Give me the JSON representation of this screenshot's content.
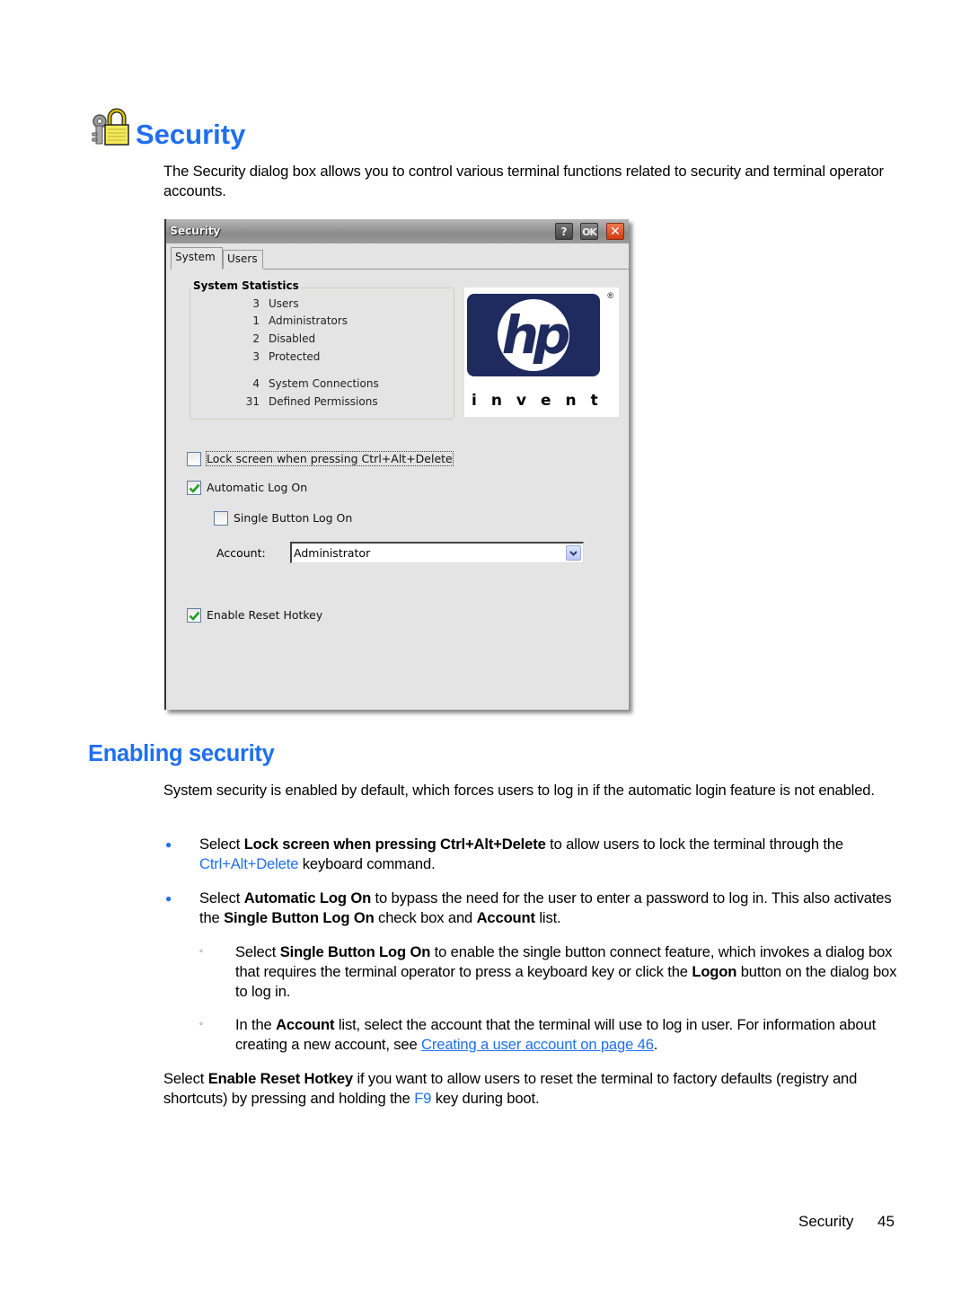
{
  "heading": {
    "title": "Security",
    "icon": "keys-and-padlock-icon"
  },
  "intro": "The Security dialog box allows you to control various terminal functions related to security and terminal operator accounts.",
  "dialog": {
    "title": "Security",
    "buttons": {
      "help": "?",
      "ok": "OK",
      "close": "✕"
    },
    "tabs": [
      {
        "label": "System",
        "active": true
      },
      {
        "label": "Users",
        "active": false
      }
    ],
    "statistics": {
      "title": "System Statistics",
      "rows": [
        {
          "value": "3",
          "label": "Users"
        },
        {
          "value": "1",
          "label": "Administrators"
        },
        {
          "value": "2",
          "label": "Disabled"
        },
        {
          "value": "3",
          "label": "Protected"
        },
        {
          "value": "4",
          "label": "System Connections"
        },
        {
          "value": "31",
          "label": "Defined Permissions"
        }
      ]
    },
    "logo": {
      "text": "hp",
      "tagline": "invent",
      "registered": "®"
    },
    "options": {
      "lock_screen": {
        "label": "Lock screen when pressing Ctrl+Alt+Delete",
        "checked": false
      },
      "auto_logon": {
        "label": "Automatic Log On",
        "checked": true
      },
      "single_button": {
        "label": "Single Button Log On",
        "checked": false
      },
      "account_label": "Account:",
      "account_value": "Administrator",
      "reset_hotkey": {
        "label": "Enable Reset Hotkey",
        "checked": true
      }
    }
  },
  "section2": {
    "title": "Enabling security",
    "intro": "System security is enabled by default, which forces users to log in if the automatic login feature is not enabled.",
    "bullet1": {
      "pre": "Select ",
      "bold": "Lock screen when pressing Ctrl+Alt+Delete",
      "mid": " to allow users to lock the terminal through the ",
      "link": "Ctrl+Alt+Delete",
      "post": " keyboard command."
    },
    "bullet2": {
      "pre": "Select ",
      "bold1": "Automatic Log On",
      "mid1": " to bypass the need for the user to enter a password to log in. This also activates the ",
      "bold2": "Single Button Log On",
      "mid2": " check box and ",
      "bold3": "Account",
      "post": " list."
    },
    "sub1": {
      "pre": "Select ",
      "bold1": "Single Button Log On",
      "mid": " to enable the single button connect feature, which invokes a dialog box that requires the terminal operator to press a keyboard key or click the ",
      "bold2": "Logon",
      "post": " button on the dialog box to log in."
    },
    "sub2": {
      "pre": "In the ",
      "bold": "Account",
      "mid": " list, select the account that the terminal will use to log in user. For information about creating a new account, see ",
      "link": "Creating a user account on page 46",
      "post": "."
    },
    "closing": {
      "pre": "Select ",
      "bold": "Enable Reset Hotkey",
      "mid": " if you want to allow users to reset the terminal to factory defaults (registry and shortcuts) by pressing and holding the ",
      "link": "F9",
      "post": " key during boot."
    }
  },
  "footer": {
    "section": "Security",
    "page": "45"
  }
}
